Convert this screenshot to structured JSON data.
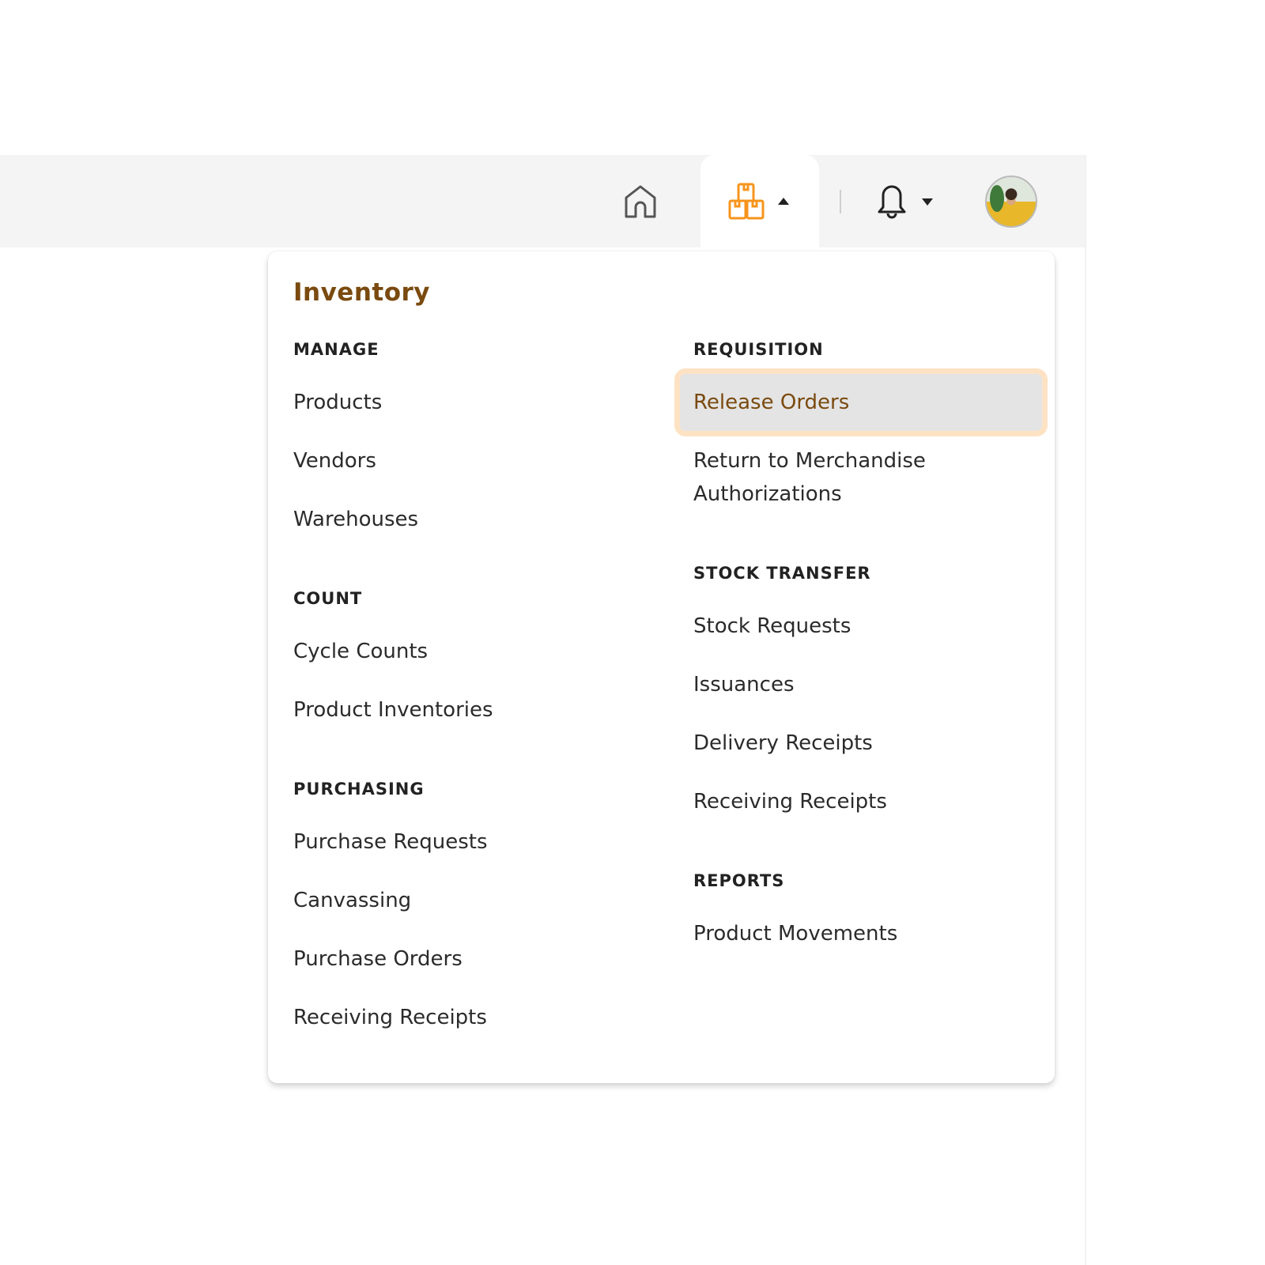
{
  "header": {
    "icons": [
      "home-icon",
      "inventory-boxes-icon",
      "caret-up-icon",
      "bell-icon",
      "caret-down-icon",
      "user-avatar"
    ],
    "accent_color": "#f7941d"
  },
  "menu": {
    "title": "Inventory",
    "left": [
      {
        "section": "MANAGE",
        "items": [
          "Products",
          "Vendors",
          "Warehouses"
        ]
      },
      {
        "section": "COUNT",
        "items": [
          "Cycle Counts",
          "Product Inventories"
        ]
      },
      {
        "section": "PURCHASING",
        "items": [
          "Purchase Requests",
          "Canvassing",
          "Purchase Orders",
          "Receiving Receipts"
        ]
      }
    ],
    "right": [
      {
        "section": "REQUISITION",
        "items": [
          "Release Orders",
          "Return to Merchandise Authorizations"
        ]
      },
      {
        "section": "STOCK TRANSFER",
        "items": [
          "Stock Requests",
          "Issuances",
          "Delivery Receipts",
          "Receiving Receipts"
        ]
      },
      {
        "section": "REPORTS",
        "items": [
          "Product Movements"
        ]
      }
    ],
    "active_item": "Release Orders",
    "title_color": "#7a4a0f"
  }
}
